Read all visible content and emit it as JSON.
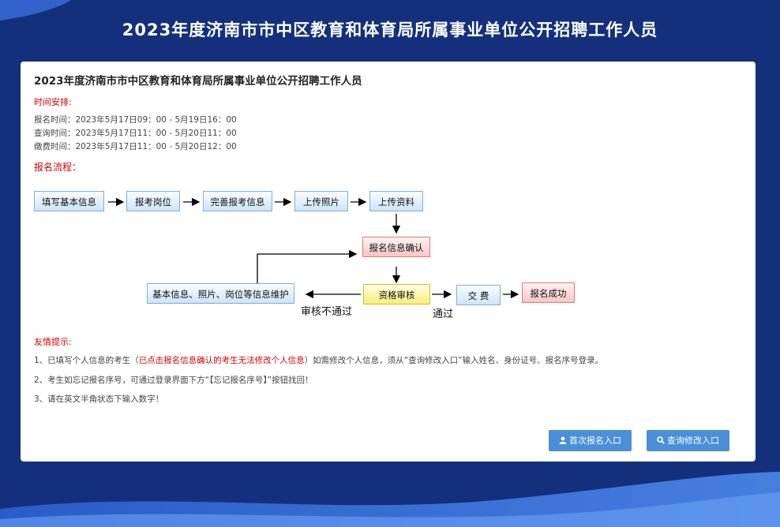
{
  "page_title": "2023年度济南市市中区教育和体育局所属事业单位公开招聘工作人员",
  "card": {
    "title": "2023年度济南市市中区教育和体育局所属事业单位公开招聘工作人员",
    "schedule_label": "时间安排:",
    "schedule": [
      "报名时间：2023年5月17日09：00 - 5月19日16：00",
      "查询时间：2023年5月17日11：00 - 5月20日11：00",
      "缴费时间：2023年5月17日11：00 - 5月20日12：00"
    ],
    "flow_label": "报名流程：",
    "flow": {
      "step1": "填写基本信息",
      "step2": "报考岗位",
      "step3": "完善报考信息",
      "step4": "上传照片",
      "step5": "上传资料",
      "confirm": "报名信息确认",
      "review": "资格审核",
      "maintain": "基本信息、照片、岗位等信息维护",
      "pay": "交 费",
      "success": "报名成功",
      "fail_text": "审核不通过",
      "pass_text": "通过"
    },
    "tips_label": "友情提示:",
    "tips": {
      "tip1_a": "1、已填写个人信息的考生（",
      "tip1_red": "已点击报名信息确认的考生无法修改个人信息",
      "tip1_b": "）如需修改个人信息，须从“查询修改入口”输入姓名、身份证号、报名序号登录。",
      "tip2": "2、考生如忘记报名序号，可通过登录界面下方“【忘记报名序号】”按钮找回！",
      "tip3": "3、请在英文半角状态下输入数字！"
    },
    "buttons": {
      "first_signup": "首次报名入口",
      "query_modify": "查询修改入口"
    }
  },
  "colors": {
    "background": "#14307d",
    "button": "#4a8fd8",
    "accent_red": "#d40000"
  }
}
